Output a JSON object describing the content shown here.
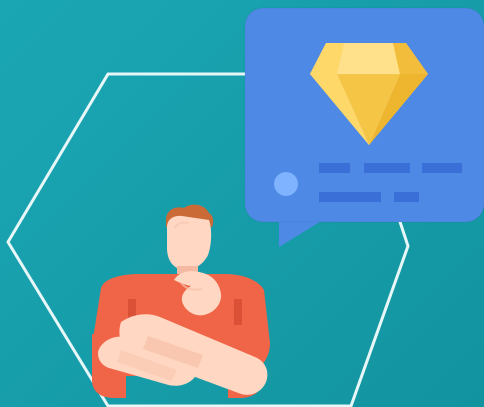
{
  "illustration": {
    "subject": "person-thinking-about-diamond",
    "icons": [
      "hexagon-outline",
      "speech-bubble",
      "diamond-icon",
      "avatar-dot",
      "placeholder-text-lines",
      "thinking-person"
    ]
  },
  "colors": {
    "background": "#139aa6",
    "hexagon_stroke": "#e7f7f8",
    "bubble": "#4f89e6",
    "bubble_shadow": "#3f79d6",
    "text_placeholder": "#3a6fd8",
    "avatar_dot": "#7fb2ff",
    "diamond_light": "#ffd86a",
    "diamond_mid": "#f7c84a",
    "diamond_dark": "#eeb52e",
    "shirt": "#f06447",
    "shirt_dark": "#d84f36",
    "skin": "#ffd7c2",
    "skin_shadow": "#f4b9a0",
    "hair": "#ca6a37"
  }
}
